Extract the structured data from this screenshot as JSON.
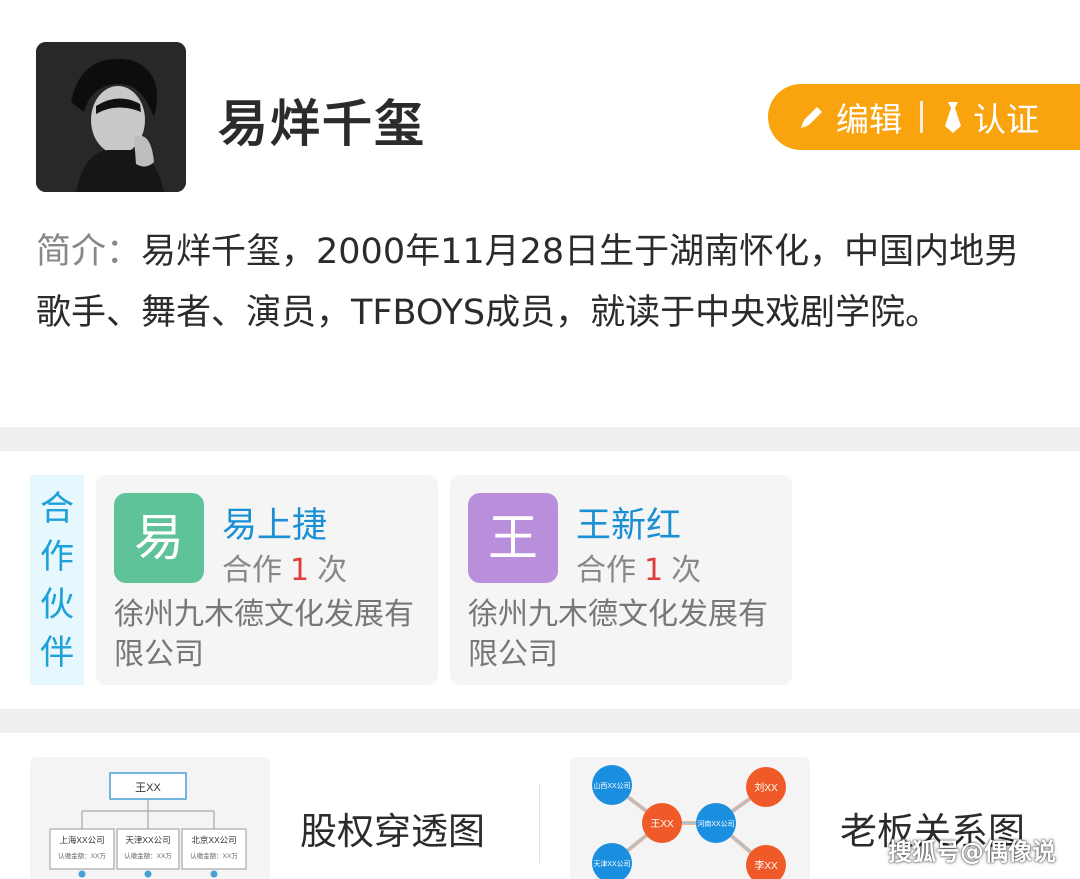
{
  "profile": {
    "name": "易烊千玺",
    "edit_label": "编辑",
    "certify_label": "认证",
    "intro_label": "简介：",
    "intro_text": "易烊千玺，2000年11月28日生于湖南怀化，中国内地男歌手、舞者、演员，TFBOYS成员，就读于中央戏剧学院。"
  },
  "partners": {
    "section_label": "合作伙伴",
    "items": [
      {
        "avatar_char": "易",
        "avatar_color": "#5fc39a",
        "name": "易上捷",
        "count_prefix": "合作",
        "count": "1",
        "count_suffix": "次",
        "company": "徐州九木德文化发展有限公司"
      },
      {
        "avatar_char": "王",
        "avatar_color": "#b98fdb",
        "name": "王新红",
        "count_prefix": "合作",
        "count": "1",
        "count_suffix": "次",
        "company": "徐州九木德文化发展有限公司"
      }
    ]
  },
  "tools": {
    "equity": {
      "label": "股权穿透图",
      "root": "王XX",
      "companies": [
        "上海XX公司",
        "天津XX公司",
        "北京XX公司"
      ],
      "amount_text": "认缴金额：XX万"
    },
    "boss": {
      "label": "老板关系图",
      "nodes": [
        "山西XX公司",
        "王XX",
        "河南XX公司",
        "刘XX",
        "天津XX公司",
        "李XX"
      ]
    }
  },
  "colors": {
    "accent_orange": "#f9a30f",
    "link_blue": "#1a8fd4",
    "count_red": "#e03c3c"
  },
  "watermark": "搜狐号@偶像说"
}
